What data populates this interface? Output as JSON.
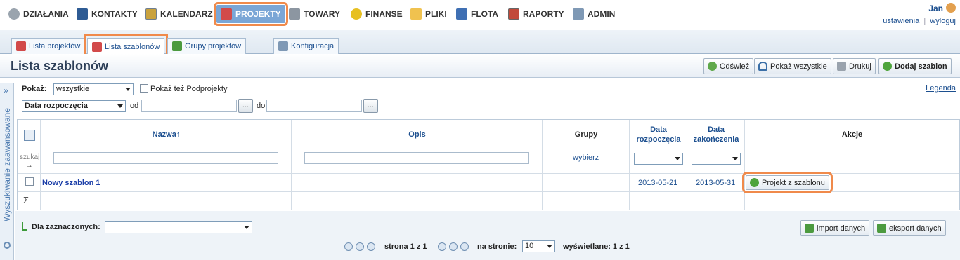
{
  "nav": {
    "items": [
      {
        "label": "DZIAŁANIA",
        "icon": "gear-icon"
      },
      {
        "label": "KONTAKTY",
        "icon": "contacts-book-icon"
      },
      {
        "label": "KALENDARZ",
        "icon": "calendar-icon"
      },
      {
        "label": "PROJEKTY",
        "icon": "projects-cubes-icon"
      },
      {
        "label": "TOWARY",
        "icon": "cart-icon"
      },
      {
        "label": "FINANSE",
        "icon": "coins-icon"
      },
      {
        "label": "PLIKI",
        "icon": "folder-icon"
      },
      {
        "label": "FLOTA",
        "icon": "car-icon"
      },
      {
        "label": "RAPORTY",
        "icon": "report-icon"
      },
      {
        "label": "ADMIN",
        "icon": "wrench-icon"
      }
    ],
    "active": "PROJEKTY"
  },
  "user": {
    "name": "Jan",
    "settings": "ustawienia",
    "logout": "wyloguj"
  },
  "tabs": [
    {
      "label": "Lista projektów"
    },
    {
      "label": "Lista szablonów"
    },
    {
      "label": "Grupy projektów"
    },
    {
      "label": "Konfiguracja"
    }
  ],
  "title": "Lista szablonów",
  "toolbar": {
    "refresh": "Odśwież",
    "show_all": "Pokaż wszystkie",
    "print": "Drukuj",
    "add": "Dodaj szablon"
  },
  "side_panel": {
    "label": "Wyszukiwanie zaawansowane",
    "toggle": "»"
  },
  "filters": {
    "show_label": "Pokaż:",
    "show_value": "wszystkie",
    "subprojects_label": "Pokaż też Podprojekty",
    "date_field": "Data rozpoczęcia",
    "from_label": "od",
    "to_label": "do",
    "dots": "...",
    "legend": "Legenda"
  },
  "grid": {
    "columns": {
      "name": "Nazwa↑",
      "description": "Opis",
      "groups": "Grupy",
      "start_line1": "Data",
      "start_line2": "rozpoczęcia",
      "end_line1": "Data",
      "end_line2": "zakończenia",
      "actions": "Akcje"
    },
    "search_label": "szukaj",
    "search_arrow": "→",
    "groups_filter": "wybierz",
    "rows": [
      {
        "name": "Nowy szablon 1",
        "description": "",
        "groups": "",
        "start": "2013-05-21",
        "end": "2013-05-31",
        "action": "Projekt z szablonu"
      }
    ],
    "sum_symbol": "Σ"
  },
  "bottom": {
    "selected_label": "Dla zaznaczonych:",
    "import": "import danych",
    "export": "eksport danych",
    "page_info": "strona 1 z 1",
    "per_page_label": "na stronie:",
    "per_page_value": "10",
    "shown_info": "wyświetlane: 1 z 1"
  },
  "colors": {
    "accent": "#1c4f8f",
    "highlight": "#f08a4b",
    "active_nav": "#7aa6d6"
  }
}
